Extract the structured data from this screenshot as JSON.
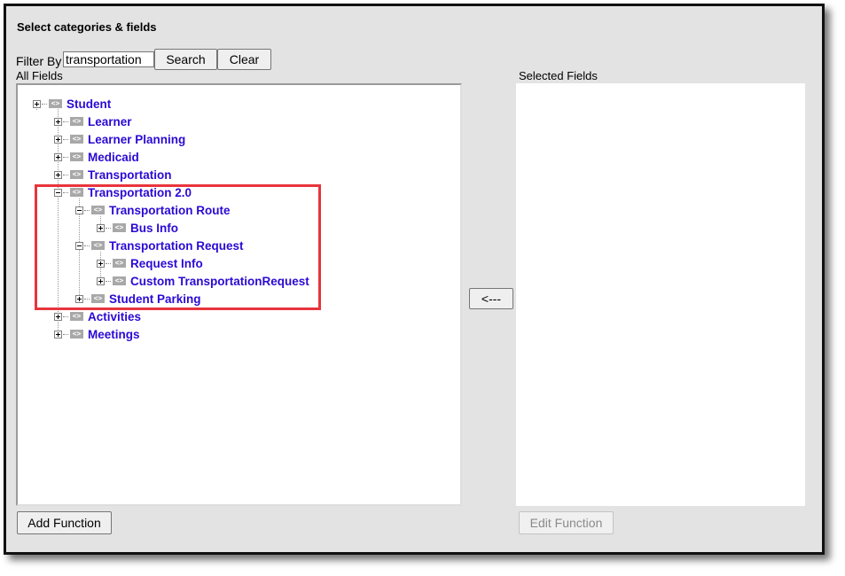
{
  "dialog": {
    "title": "Select categories & fields",
    "filter_label": "Filter By",
    "filter_value": "transportation",
    "search_label": "Search",
    "clear_label": "Clear",
    "all_fields_label": "All Fields",
    "selected_fields_label": "Selected Fields",
    "move_left_label": "<---",
    "add_function_label": "Add Function",
    "edit_function_label": "Edit Function"
  },
  "tree": {
    "student": "Student",
    "learner": "Learner",
    "learner_planning": "Learner Planning",
    "medicaid": "Medicaid",
    "transportation": "Transportation",
    "transportation_2": "Transportation 2.0",
    "transportation_route": "Transportation Route",
    "bus_info": "Bus Info",
    "transportation_request": "Transportation Request",
    "request_info": "Request Info",
    "custom_transportation_request": "Custom TransportationRequest",
    "student_parking": "Student Parking",
    "activities": "Activities",
    "meetings": "Meetings",
    "tag_glyph": "<>"
  },
  "colors": {
    "node_text": "#2a0ad4",
    "highlight": "#e8343c",
    "window_bg": "#e3e3e3"
  }
}
